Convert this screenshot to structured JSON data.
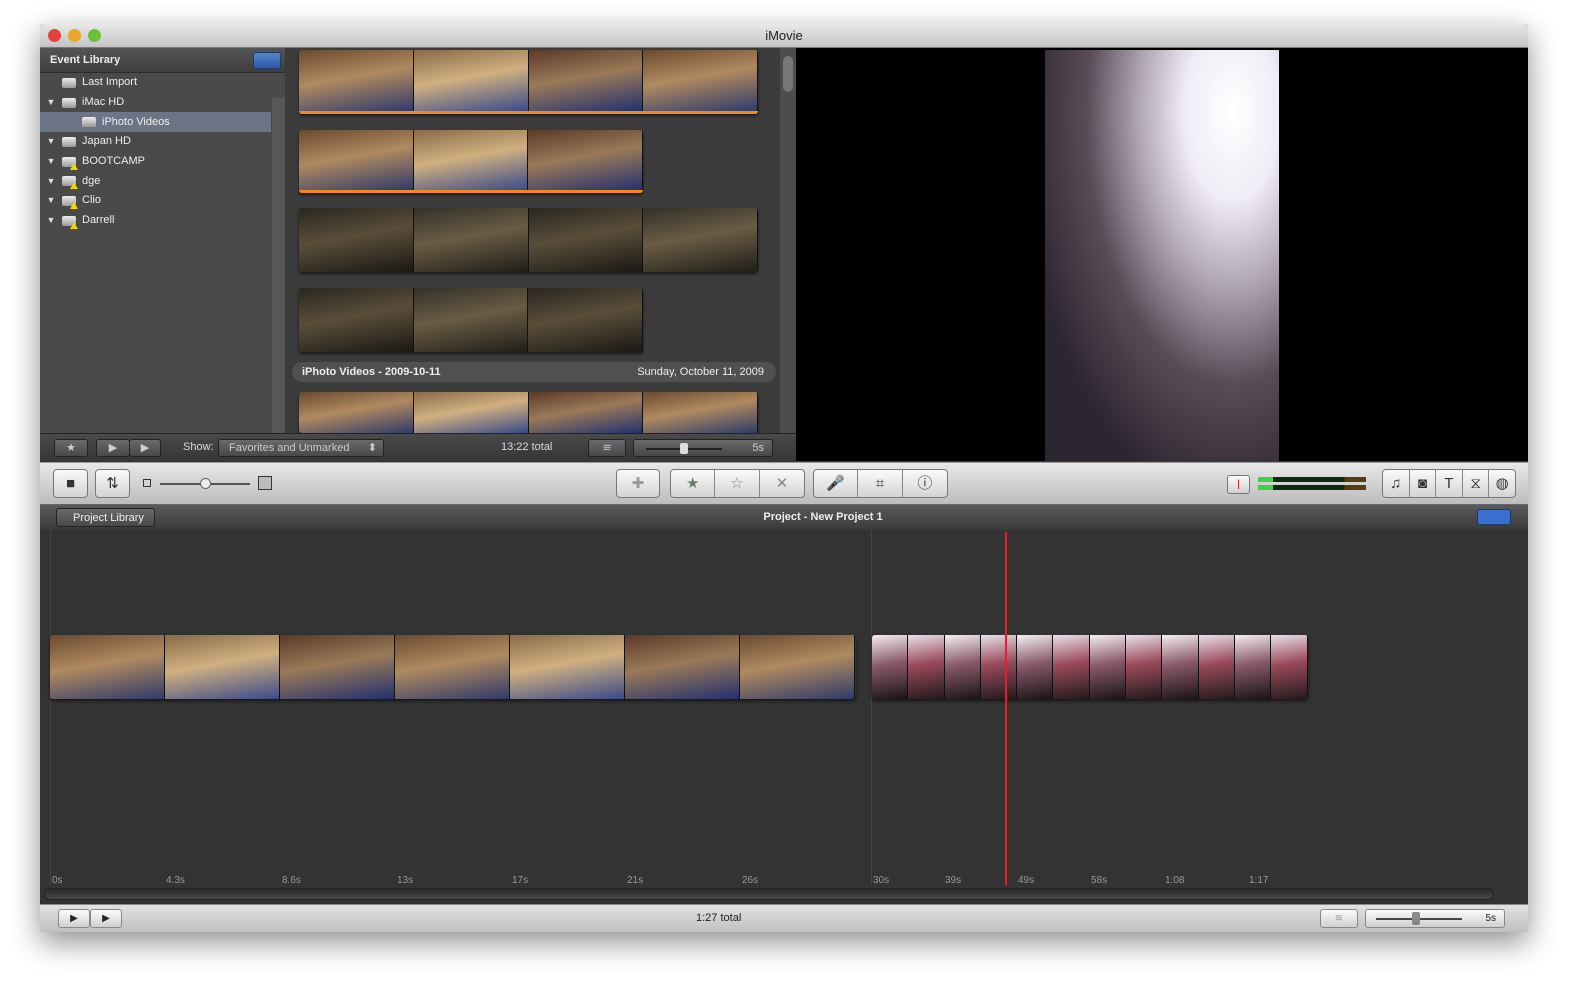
{
  "window": {
    "title": "iMovie"
  },
  "event_library": {
    "title": "Event Library",
    "items": [
      {
        "label": "Last Import",
        "icon": "film-roll-icon",
        "expand": ""
      },
      {
        "label": "iMac HD",
        "icon": "imac-icon",
        "expand": "▼"
      },
      {
        "label": "iPhoto Videos",
        "icon": "iphoto-icon",
        "expand": "",
        "selected": true
      },
      {
        "label": "Japan HD",
        "icon": "drive-icon",
        "expand": "▼"
      },
      {
        "label": "BOOTCAMP",
        "icon": "drive-warning-icon",
        "expand": "▼"
      },
      {
        "label": "dge",
        "icon": "drive-warning-icon",
        "expand": "▼"
      },
      {
        "label": "Clio",
        "icon": "drive-warning-icon",
        "expand": "▼"
      },
      {
        "label": "Darrell",
        "icon": "drive-warning-icon",
        "expand": "▼"
      }
    ]
  },
  "event_browser": {
    "event_title": "iPhoto Videos - 2009-10-11",
    "event_date": "Sunday, October 11, 2009"
  },
  "event_bar": {
    "show_label": "Show:",
    "show_value": "Favorites and Unmarked",
    "total": "13:22 total",
    "duration": "5s"
  },
  "project": {
    "back_label": "Project Library",
    "title": "Project - New Project 1"
  },
  "timeline": {
    "ticks": [
      "0s",
      "4.3s",
      "8.6s",
      "13s",
      "17s",
      "21s",
      "26s",
      "30s",
      "39s",
      "49s",
      "58s",
      "1:08",
      "1:17"
    ],
    "playhead_color": "#e0202a"
  },
  "bottom_bar": {
    "total": "1:27 total",
    "duration": "5s"
  },
  "colors": {
    "selection_orange": "#f08a1c",
    "meter_green": "#3bd34a",
    "project_button_blue": "#3a6fd0"
  }
}
